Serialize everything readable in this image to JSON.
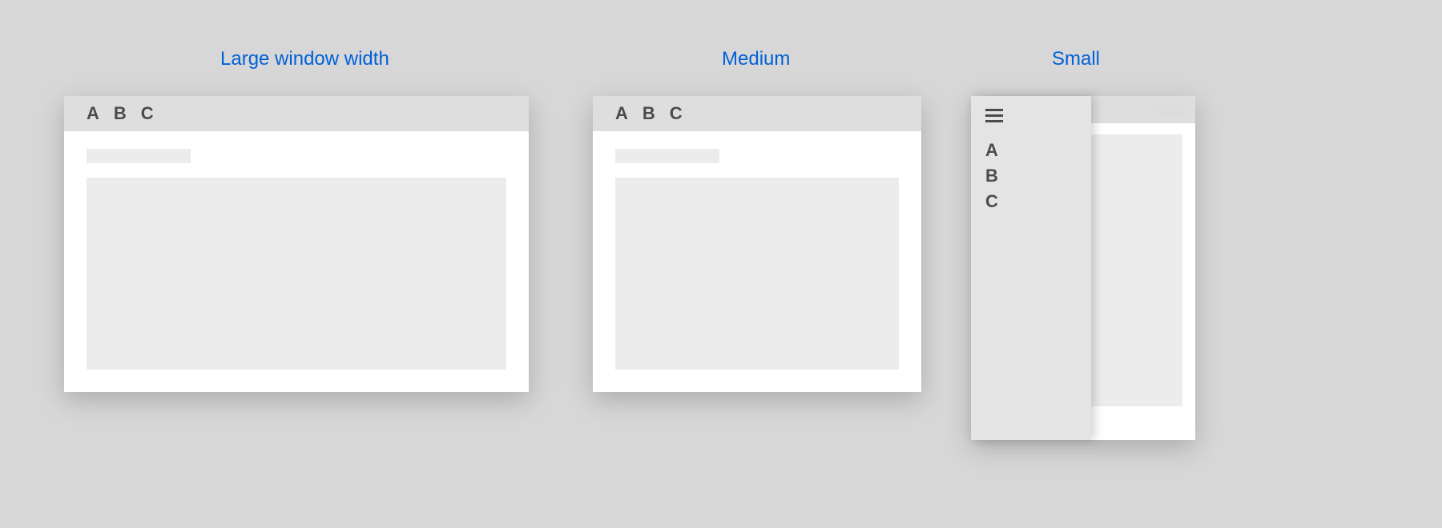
{
  "labels": {
    "large": "Large window width",
    "medium": "Medium",
    "small": "Small"
  },
  "tabs": {
    "a": "A",
    "b": "B",
    "c": "C"
  }
}
